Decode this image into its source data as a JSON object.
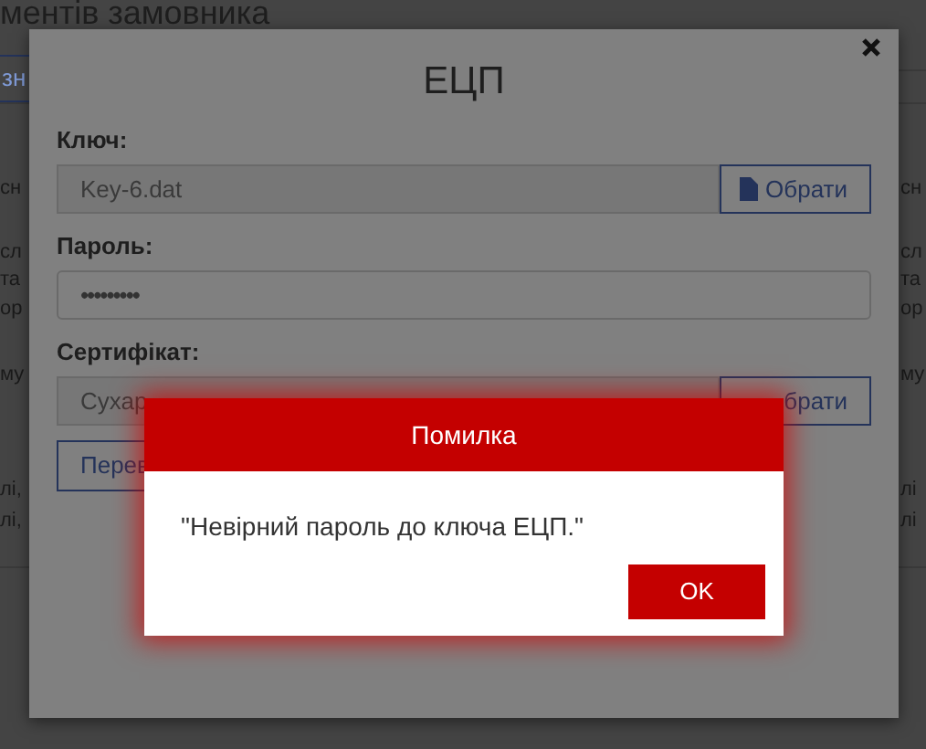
{
  "page": {
    "heading": "ментів замовника",
    "tab": "зн",
    "left_fragments": [
      "сн",
      "сл",
      "та",
      "ор",
      "му",
      "лі,",
      "лі,"
    ],
    "right_fragments": [
      "сн",
      "сл",
      "та",
      "ор",
      "му",
      "лі",
      "лі"
    ]
  },
  "dialog": {
    "title": "ЕЦП",
    "fields": [
      {
        "kind": "file",
        "label": "Ключ:",
        "value": "Key-6.dat",
        "button": "Обрати",
        "button_icon": true
      },
      {
        "kind": "password",
        "label": "Пароль:",
        "value": "•••••••••"
      },
      {
        "kind": "file",
        "label": "Сертифікат:",
        "value": "Сухар",
        "button": "брати",
        "button_icon": false
      }
    ],
    "action_button": "Перев"
  },
  "error": {
    "title": "Помилка",
    "message": "\"Невірний пароль до ключа ЕЦП.\"",
    "ok": "OK"
  }
}
